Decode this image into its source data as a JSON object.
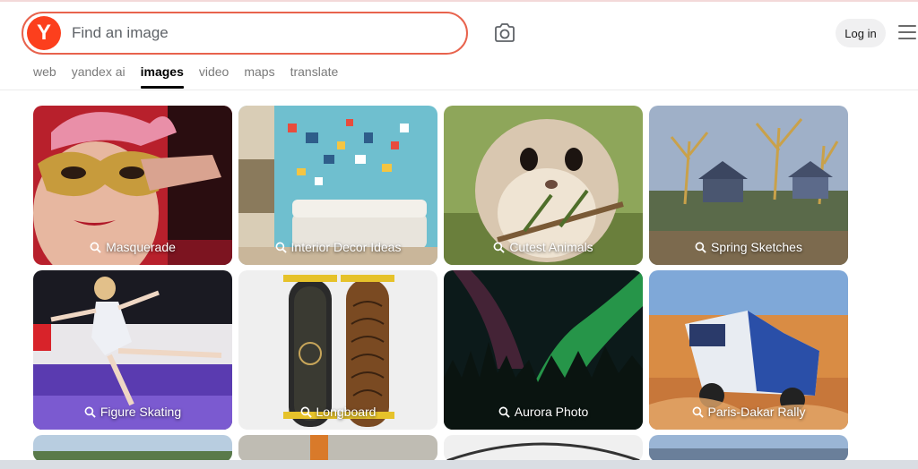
{
  "header": {
    "logo_letter": "Y",
    "search_placeholder": "Find an image",
    "login_label": "Log in"
  },
  "tabs": [
    {
      "label": "web",
      "active": false
    },
    {
      "label": "yandex ai",
      "active": false
    },
    {
      "label": "images",
      "active": true
    },
    {
      "label": "video",
      "active": false
    },
    {
      "label": "maps",
      "active": false
    },
    {
      "label": "translate",
      "active": false
    }
  ],
  "cards": [
    {
      "label": "Masquerade"
    },
    {
      "label": "Interior Decor Ideas"
    },
    {
      "label": "Cutest Animals"
    },
    {
      "label": "Spring Sketches"
    },
    {
      "label": "Figure Skating"
    },
    {
      "label": "Longboard"
    },
    {
      "label": "Aurora Photo"
    },
    {
      "label": "Paris-Dakar Rally"
    }
  ],
  "colors": {
    "brand_red": "#fc3f1d",
    "search_border": "#e8634d"
  }
}
